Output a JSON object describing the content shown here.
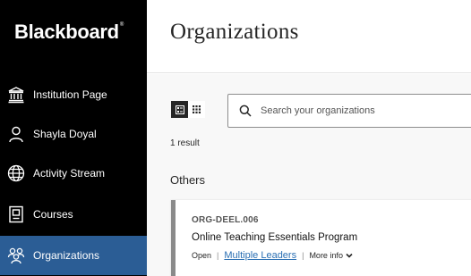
{
  "app": {
    "logo_text": "Blackboard",
    "logo_mark": "®"
  },
  "sidebar": {
    "items": [
      {
        "label": "Institution Page",
        "icon": "institution-icon",
        "active": false
      },
      {
        "label": "Shayla Doyal",
        "icon": "user-icon",
        "active": false
      },
      {
        "label": "Activity Stream",
        "icon": "globe-icon",
        "active": false
      },
      {
        "label": "Courses",
        "icon": "courses-icon",
        "active": false
      },
      {
        "label": "Organizations",
        "icon": "organizations-icon",
        "active": true
      }
    ]
  },
  "page": {
    "title": "Organizations"
  },
  "toolbar": {
    "view_modes": [
      "list-view-icon",
      "grid-view-icon"
    ],
    "search": {
      "placeholder": "Search your organizations",
      "value": ""
    }
  },
  "results": {
    "count_label": "1 result"
  },
  "section": {
    "title": "Others"
  },
  "organization": {
    "code": "ORG-DEEL.006",
    "name": "Online Teaching Essentials Program",
    "status": "Open",
    "leaders_link": "Multiple Leaders",
    "more_info": "More info"
  },
  "colors": {
    "sidebar_bg": "#000000",
    "active_bg": "#2b5d95",
    "link": "#2a6fb3",
    "card_accent": "#8a8a8a"
  }
}
